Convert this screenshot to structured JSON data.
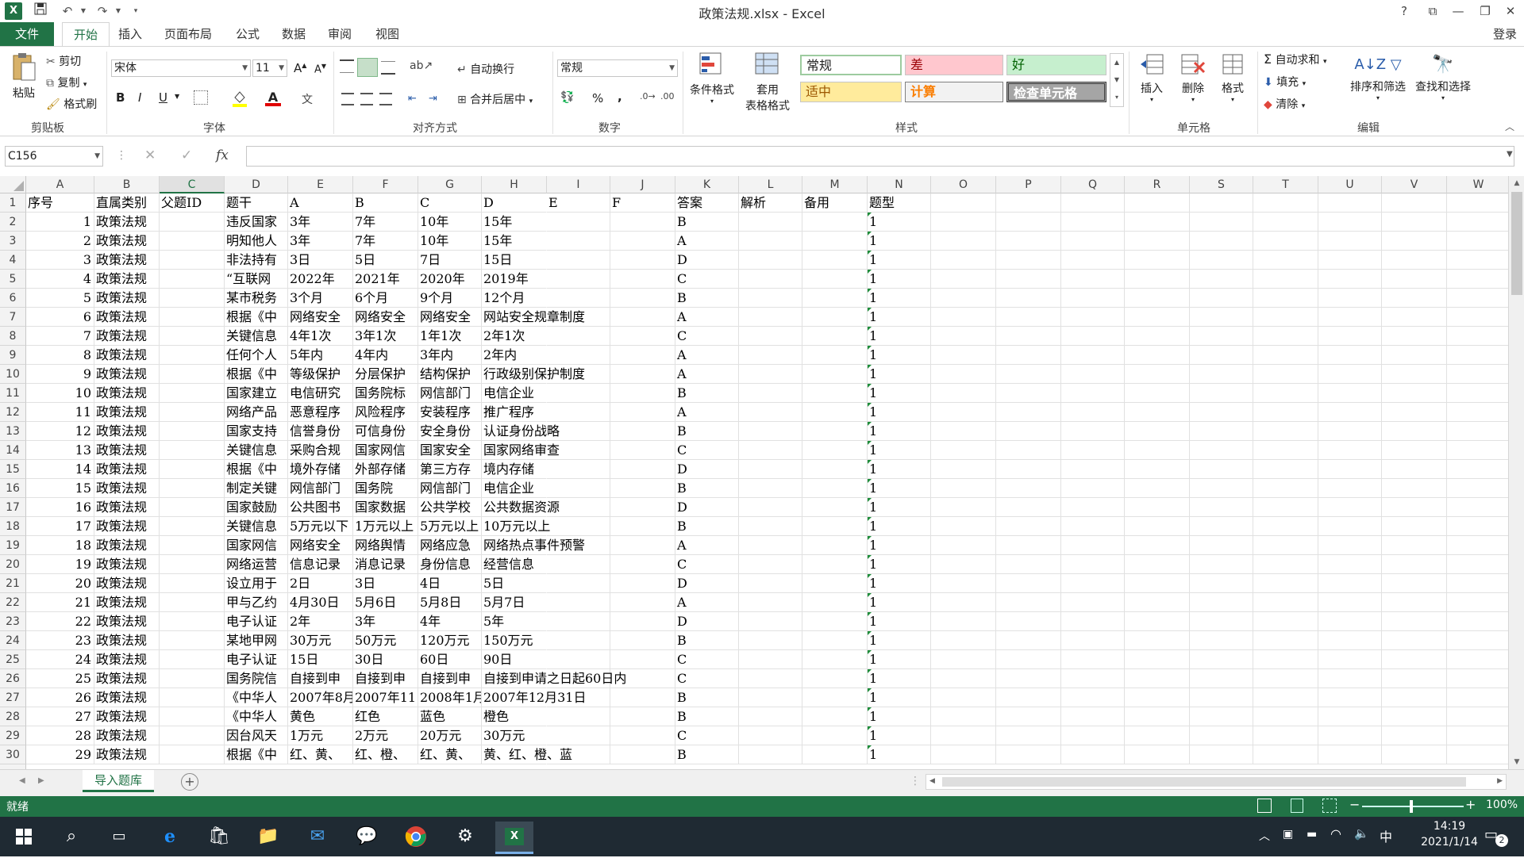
{
  "window": {
    "title": "政策法规.xlsx - Excel",
    "help": "?",
    "login": "登录"
  },
  "tabs": [
    "文件",
    "开始",
    "插入",
    "页面布局",
    "公式",
    "数据",
    "审阅",
    "视图"
  ],
  "ribbon": {
    "clipboard": {
      "paste": "粘贴",
      "cut": "剪切",
      "copy": "复制",
      "format_painter": "格式刷",
      "label": "剪贴板"
    },
    "font": {
      "name": "宋体",
      "size": "11",
      "label": "字体",
      "bold": "B",
      "italic": "I",
      "underline": "U",
      "grow": "A",
      "shrink": "A"
    },
    "align": {
      "wrap": "自动换行",
      "merge": "合并后居中",
      "label": "对齐方式"
    },
    "number": {
      "format": "常规",
      "percent": "%",
      "comma": ",",
      "label": "数字"
    },
    "styles": {
      "cond": "条件格式",
      "table": "套用",
      "table2": "表格格式",
      "label": "样式",
      "boxes": [
        {
          "t": "常规"
        },
        {
          "t": "差"
        },
        {
          "t": "好"
        },
        {
          "t": "适中"
        },
        {
          "t": "计算"
        },
        {
          "t": "检查单元格"
        }
      ]
    },
    "cells": {
      "insert": "插入",
      "delete": "删除",
      "format": "格式",
      "label": "单元格"
    },
    "editing": {
      "autosum": "自动求和",
      "fill": "填充",
      "clear": "清除",
      "sort": "排序和筛选",
      "find": "查找和选择",
      "label": "编辑"
    }
  },
  "formula": {
    "namebox": "C156",
    "fx": "fx",
    "x": "✕",
    "check": "✓",
    "value": ""
  },
  "columns": [
    "A",
    "B",
    "C",
    "D",
    "E",
    "F",
    "G",
    "H",
    "I",
    "J",
    "K",
    "L",
    "M",
    "N",
    "O",
    "P",
    "Q",
    "R",
    "S",
    "T",
    "U",
    "V",
    "W"
  ],
  "selected_column": "C",
  "rows": [
    {
      "n": "1",
      "a": "序号",
      "b": "直属类别",
      "c": "父题ID",
      "d": "题干",
      "e": "A",
      "f": "B",
      "g": "C",
      "h": "D",
      "i": "E",
      "j": "F",
      "k": "答案",
      "l": "解析",
      "m": "备用",
      "nn": "题型"
    },
    {
      "n": "2",
      "a": "1",
      "b": "政策法规",
      "d": "违反国家",
      "e": "3年",
      "f": "7年",
      "g": "10年",
      "h": "15年",
      "k": "B",
      "nn": "1"
    },
    {
      "n": "3",
      "a": "2",
      "b": "政策法规",
      "d": "明知他人",
      "e": "3年",
      "f": "7年",
      "g": "10年",
      "h": "15年",
      "k": "A",
      "nn": "1"
    },
    {
      "n": "4",
      "a": "3",
      "b": "政策法规",
      "d": "非法持有",
      "e": "3日",
      "f": "5日",
      "g": "7日",
      "h": "15日",
      "k": "D",
      "nn": "1"
    },
    {
      "n": "5",
      "a": "4",
      "b": "政策法规",
      "d": "“互联网",
      "e": "2022年",
      "f": "2021年",
      "g": "2020年",
      "h": "2019年",
      "k": "C",
      "nn": "1"
    },
    {
      "n": "6",
      "a": "5",
      "b": "政策法规",
      "d": "某市税务",
      "e": "3个月",
      "f": "6个月",
      "g": "9个月",
      "h": "12个月",
      "k": "B",
      "nn": "1"
    },
    {
      "n": "7",
      "a": "6",
      "b": "政策法规",
      "d": "根据《中",
      "e": "网络安全",
      "f": "网络安全",
      "g": "网络安全",
      "h": "网站安全规章制度",
      "k": "A",
      "nn": "1"
    },
    {
      "n": "8",
      "a": "7",
      "b": "政策法规",
      "d": "关键信息",
      "e": "4年1次",
      "f": "3年1次",
      "g": "1年1次",
      "h": "2年1次",
      "k": "C",
      "nn": "1"
    },
    {
      "n": "9",
      "a": "8",
      "b": "政策法规",
      "d": "任何个人",
      "e": "5年内",
      "f": "4年内",
      "g": "3年内",
      "h": "2年内",
      "k": "A",
      "nn": "1"
    },
    {
      "n": "10",
      "a": "9",
      "b": "政策法规",
      "d": "根据《中",
      "e": "等级保护",
      "f": "分层保护",
      "g": "结构保护",
      "h": "行政级别保护制度",
      "k": "A",
      "nn": "1"
    },
    {
      "n": "11",
      "a": "10",
      "b": "政策法规",
      "d": "国家建立",
      "e": "电信研究",
      "f": "国务院标",
      "g": "网信部门",
      "h": "电信企业",
      "k": "B",
      "nn": "1"
    },
    {
      "n": "12",
      "a": "11",
      "b": "政策法规",
      "d": "网络产品",
      "e": "恶意程序",
      "f": "风险程序",
      "g": "安装程序",
      "h": "推广程序",
      "k": "A",
      "nn": "1"
    },
    {
      "n": "13",
      "a": "12",
      "b": "政策法规",
      "d": "国家支持",
      "e": "信誉身份",
      "f": "可信身份",
      "g": "安全身份",
      "h": "认证身份战略",
      "k": "B",
      "nn": "1"
    },
    {
      "n": "14",
      "a": "13",
      "b": "政策法规",
      "d": "关键信息",
      "e": "采购合规",
      "f": "国家网信",
      "g": "国家安全",
      "h": "国家网络审查",
      "k": "C",
      "nn": "1"
    },
    {
      "n": "15",
      "a": "14",
      "b": "政策法规",
      "d": "根据《中",
      "e": "境外存储",
      "f": "外部存储",
      "g": "第三方存",
      "h": "境内存储",
      "k": "D",
      "nn": "1"
    },
    {
      "n": "16",
      "a": "15",
      "b": "政策法规",
      "d": "制定关键",
      "e": "网信部门",
      "f": "国务院",
      "g": "网信部门",
      "h": "电信企业",
      "k": "B",
      "nn": "1"
    },
    {
      "n": "17",
      "a": "16",
      "b": "政策法规",
      "d": "国家鼓励",
      "e": "公共图书",
      "f": "国家数据",
      "g": "公共学校",
      "h": "公共数据资源",
      "k": "D",
      "nn": "1"
    },
    {
      "n": "18",
      "a": "17",
      "b": "政策法规",
      "d": "关键信息",
      "e": "5万元以下",
      "f": "1万元以上",
      "g": "5万元以上",
      "h": "10万元以上",
      "k": "B",
      "nn": "1"
    },
    {
      "n": "19",
      "a": "18",
      "b": "政策法规",
      "d": "国家网信",
      "e": "网络安全",
      "f": "网络舆情",
      "g": "网络应急",
      "h": "网络热点事件预警",
      "k": "A",
      "nn": "1"
    },
    {
      "n": "20",
      "a": "19",
      "b": "政策法规",
      "d": "网络运营",
      "e": "信息记录",
      "f": "消息记录",
      "g": "身份信息",
      "h": "经营信息",
      "k": "C",
      "nn": "1"
    },
    {
      "n": "21",
      "a": "20",
      "b": "政策法规",
      "d": "设立用于",
      "e": "2日",
      "f": "3日",
      "g": "4日",
      "h": "5日",
      "k": "D",
      "nn": "1"
    },
    {
      "n": "22",
      "a": "21",
      "b": "政策法规",
      "d": "甲与乙约",
      "e": "4月30日",
      "f": "5月6日",
      "g": "5月8日",
      "h": "5月7日",
      "k": "A",
      "nn": "1"
    },
    {
      "n": "23",
      "a": "22",
      "b": "政策法规",
      "d": "电子认证",
      "e": "2年",
      "f": "3年",
      "g": "4年",
      "h": "5年",
      "k": "D",
      "nn": "1"
    },
    {
      "n": "24",
      "a": "23",
      "b": "政策法规",
      "d": "某地甲网",
      "e": "30万元",
      "f": "50万元",
      "g": "120万元",
      "h": "150万元",
      "k": "B",
      "nn": "1"
    },
    {
      "n": "25",
      "a": "24",
      "b": "政策法规",
      "d": "电子认证",
      "e": "15日",
      "f": "30日",
      "g": "60日",
      "h": "90日",
      "k": "C",
      "nn": "1"
    },
    {
      "n": "26",
      "a": "25",
      "b": "政策法规",
      "d": "国务院信",
      "e": "自接到申",
      "f": "自接到申",
      "g": "自接到申",
      "h": "自接到申请之日起60日内",
      "k": "C",
      "nn": "1"
    },
    {
      "n": "27",
      "a": "26",
      "b": "政策法规",
      "d": "《中华人",
      "e": "2007年8月",
      "f": "2007年11",
      "g": "2008年1月",
      "h": "2007年12月31日",
      "k": "B",
      "nn": "1"
    },
    {
      "n": "28",
      "a": "27",
      "b": "政策法规",
      "d": "《中华人",
      "e": "黄色",
      "f": "红色",
      "g": "蓝色",
      "h": "橙色",
      "k": "B",
      "nn": "1"
    },
    {
      "n": "29",
      "a": "28",
      "b": "政策法规",
      "d": "因台风天",
      "e": "1万元",
      "f": "2万元",
      "g": "20万元",
      "h": "30万元",
      "k": "C",
      "nn": "1"
    },
    {
      "n": "30",
      "a": "29",
      "b": "政策法规",
      "d": "根据《中",
      "e": "红、黄、",
      "f": "红、橙、",
      "g": "红、黄、",
      "h": "黄、红、橙、蓝",
      "k": "B",
      "nn": "1"
    }
  ],
  "sheets": {
    "active": "导入题库",
    "add": "+"
  },
  "status": {
    "ready": "就绪",
    "zoom": "100%",
    "minus": "−",
    "plus": "+"
  },
  "taskbar": {
    "time": "14:19",
    "date": "2021/1/14",
    "ime": "中",
    "badge": "2"
  }
}
